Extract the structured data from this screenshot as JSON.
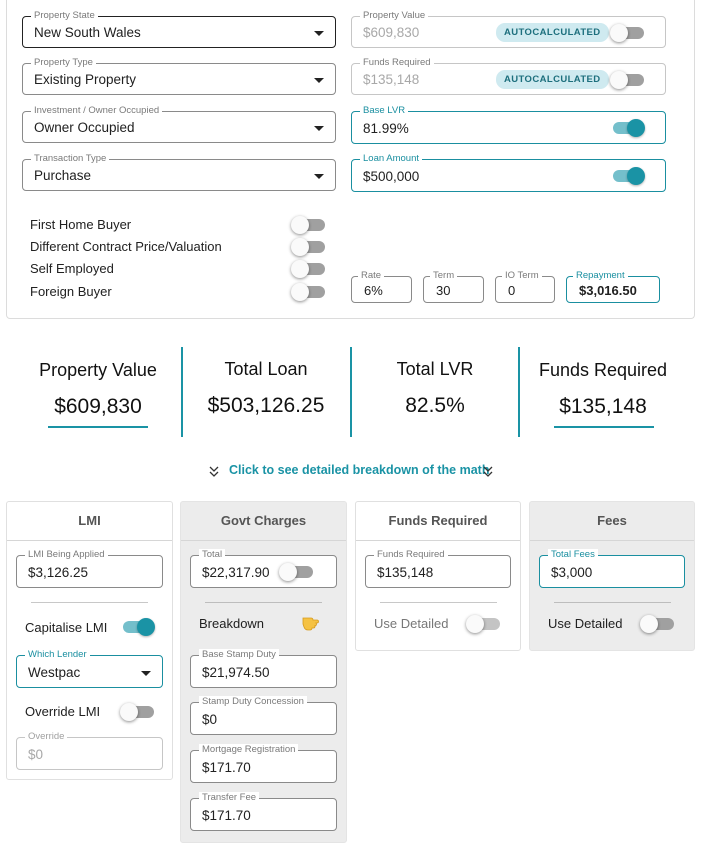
{
  "property_form": {
    "property_state": {
      "label": "Property State",
      "value": "New South Wales"
    },
    "property_type": {
      "label": "Property Type",
      "value": "Existing Property"
    },
    "occupancy": {
      "label": "Investment / Owner Occupied",
      "value": "Owner Occupied"
    },
    "transaction_type": {
      "label": "Transaction Type",
      "value": "Purchase"
    },
    "property_value": {
      "label": "Property Value",
      "value": "$609,830",
      "chip": "AUTOCALCULATED",
      "toggle_on": false
    },
    "funds_required": {
      "label": "Funds Required",
      "value": "$135,148",
      "chip": "AUTOCALCULATED",
      "toggle_on": false
    },
    "base_lvr": {
      "label": "Base LVR",
      "value": "81.99%",
      "toggle_on": true
    },
    "loan_amount": {
      "label": "Loan Amount",
      "value": "$500,000",
      "toggle_on": true
    }
  },
  "flags": [
    {
      "label": "First Home Buyer",
      "on": false
    },
    {
      "label": "Different Contract Price/Valuation",
      "on": false
    },
    {
      "label": "Self Employed",
      "on": false
    },
    {
      "label": "Foreign Buyer",
      "on": false
    }
  ],
  "loan_terms": {
    "rate": {
      "label": "Rate",
      "value": "6%"
    },
    "term": {
      "label": "Term",
      "value": "30"
    },
    "io_term": {
      "label": "IO Term",
      "value": "0"
    },
    "repayment": {
      "label": "Repayment",
      "value": "$3,016.50"
    }
  },
  "summary": [
    {
      "title": "Property Value",
      "value": "$609,830"
    },
    {
      "title": "Total Loan",
      "value": "$503,126.25"
    },
    {
      "title": "Total LVR",
      "value": "82.5%"
    },
    {
      "title": "Funds Required",
      "value": "$135,148"
    }
  ],
  "breakdown_link": "Click to see detailed breakdown of the math",
  "lmi_card": {
    "title": "LMI",
    "lmi_applied": {
      "label": "LMI Being Applied",
      "value": "$3,126.25"
    },
    "capitalise_label": "Capitalise LMI",
    "capitalise_on": true,
    "lender": {
      "label": "Which Lender",
      "value": "Westpac"
    },
    "override_label": "Override LMI",
    "override_on": false,
    "override_field": {
      "label": "Override",
      "value": "$0"
    }
  },
  "govt_card": {
    "title": "Govt Charges",
    "total": {
      "label": "Total",
      "value": "$22,317.90"
    },
    "breakdown_label": "Breakdown",
    "breakdown_icon": "pointing-hand-icon",
    "base_stamp_duty": {
      "label": "Base Stamp Duty",
      "value": "$21,974.50"
    },
    "stamp_duty_concession": {
      "label": "Stamp Duty Concession",
      "value": "$0"
    },
    "mortgage_registration": {
      "label": "Mortgage Registration",
      "value": "$171.70"
    },
    "transfer_fee": {
      "label": "Transfer Fee",
      "value": "$171.70"
    }
  },
  "funds_card": {
    "title": "Funds Required",
    "funds": {
      "label": "Funds Required",
      "value": "$135,148"
    },
    "detail_label": "Use Detailed"
  },
  "fees_card": {
    "title": "Fees",
    "total_fees": {
      "label": "Total Fees",
      "value": "$3,000"
    },
    "detail_label": "Use Detailed"
  },
  "colors": {
    "accent": "#1a93a5",
    "chip_bg": "#cfeaf0",
    "grey_card": "#ececec"
  }
}
